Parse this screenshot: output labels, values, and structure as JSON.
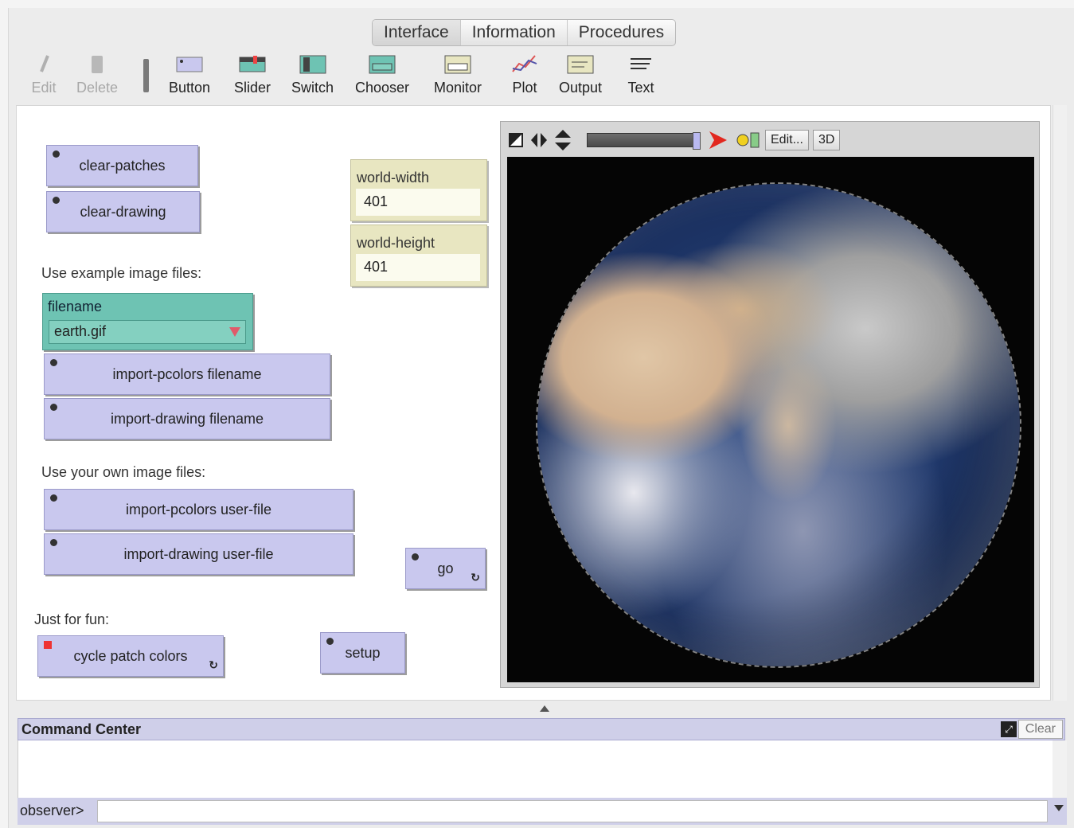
{
  "tabs": [
    "Interface",
    "Information",
    "Procedures"
  ],
  "toolbar": {
    "edit": "Edit",
    "delete": "Delete",
    "tools": [
      "Button",
      "Slider",
      "Switch",
      "Chooser",
      "Monitor",
      "Plot",
      "Output",
      "Text"
    ]
  },
  "buttons": {
    "clear_patches": "clear-patches",
    "clear_drawing": "clear-drawing",
    "import_pcolors_filename": "import-pcolors filename",
    "import_drawing_filename": "import-drawing filename",
    "import_pcolors_user": "import-pcolors user-file",
    "import_drawing_user": "import-drawing user-file",
    "go": "go",
    "cycle": "cycle patch colors",
    "setup": "setup"
  },
  "labels": {
    "example": "Use example image files:",
    "own": "Use your own image files:",
    "fun": "Just for fun:"
  },
  "chooser": {
    "label": "filename",
    "value": "earth.gif"
  },
  "monitors": {
    "width": {
      "label": "world-width",
      "value": "401"
    },
    "height": {
      "label": "world-height",
      "value": "401"
    }
  },
  "view": {
    "edit": "Edit...",
    "three_d": "3D"
  },
  "command_center": {
    "title": "Command Center",
    "clear": "Clear",
    "observer": "observer>"
  },
  "colors": {
    "button_bg": "#c9c8ee",
    "monitor_bg": "#e8e6c1",
    "chooser_bg": "#6ec3b3",
    "command_bar": "#cfcfe9"
  }
}
